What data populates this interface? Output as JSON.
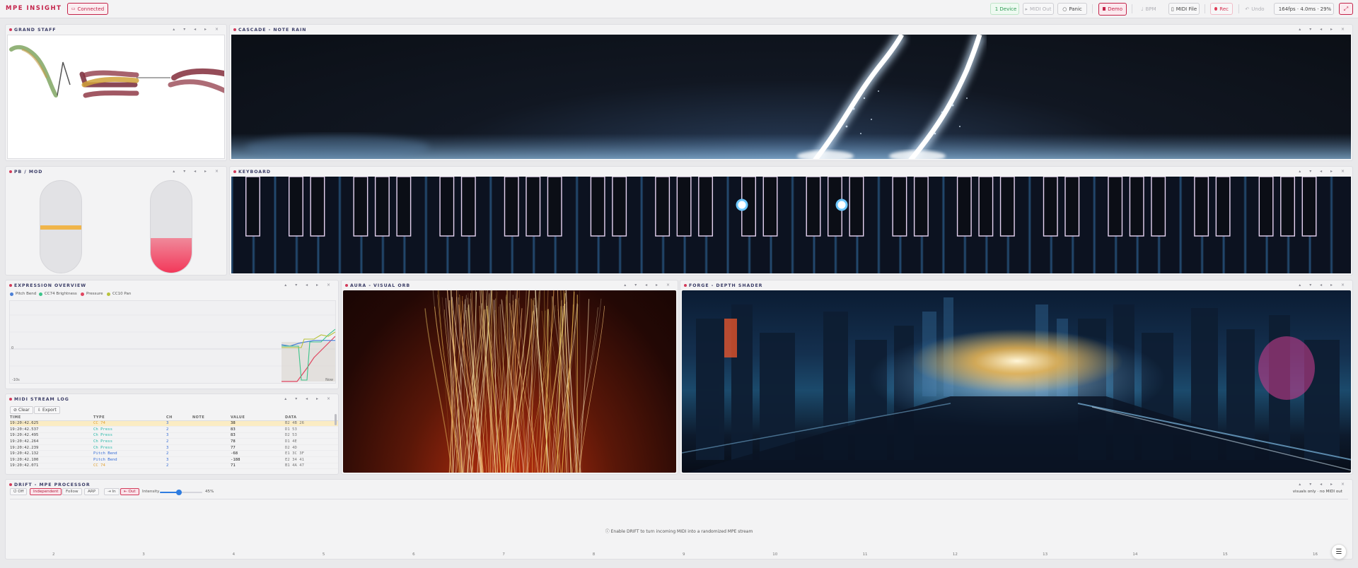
{
  "app": {
    "brand": "MPE INSIGHT"
  },
  "topbar": {
    "connected": "Connected",
    "device": "1 Device",
    "midi_out": "MIDI Out",
    "panic": "Panic",
    "demo": "Demo",
    "bpm": "BPM",
    "midi_file": "MIDI File",
    "rec": "Rec",
    "undo": "Undo",
    "perf": "164fps · 4.0ms · 29%"
  },
  "panels": {
    "grand_staff": "GRAND STAFF",
    "cascade": "CASCADE - NOTE RAIN",
    "pbmod": "PB / MOD",
    "keyboard": "KEYBOARD",
    "expression": "EXPRESSION OVERVIEW",
    "aura": "AURA - VISUAL ORB",
    "forge": "FORGE - DEPTH SHADER",
    "midi_log": "MIDI STREAM LOG",
    "drift": "DRIFT - MPE PROCESSOR"
  },
  "panel_controls": "▴ ▾ ◂ ▸ ×",
  "pbmod": {
    "pitch_bend_level": 0.5,
    "mod_level": 0.38
  },
  "expression": {
    "legend": [
      {
        "label": "Pitch Bend",
        "color": "#4a7fd6"
      },
      {
        "label": "CC74 Brightness",
        "color": "#3cc48a"
      },
      {
        "label": "Pressure",
        "color": "#e0455f"
      },
      {
        "label": "CC10 Pan",
        "color": "#b8c23a"
      }
    ],
    "y_label": "0",
    "x_start": "-10s",
    "x_end": "Now"
  },
  "midi_log": {
    "clear": "Clear",
    "export": "Export",
    "columns": [
      "TIME",
      "TYPE",
      "CH",
      "NOTE",
      "VALUE",
      "DATA"
    ],
    "rows": [
      {
        "time": "19:20:42.625",
        "type": "CC 74",
        "ch": "3",
        "note": "",
        "value": "38",
        "data": "B2 4B 26"
      },
      {
        "time": "19:20:42.537",
        "type": "Ch Press",
        "ch": "2",
        "note": "",
        "value": "83",
        "data": "D1 53"
      },
      {
        "time": "19:20:42.495",
        "type": "Ch Press",
        "ch": "3",
        "note": "",
        "value": "83",
        "data": "D2 53"
      },
      {
        "time": "19:20:42.264",
        "type": "Ch Press",
        "ch": "2",
        "note": "",
        "value": "78",
        "data": "D1 4E"
      },
      {
        "time": "19:20:42.239",
        "type": "Ch Press",
        "ch": "3",
        "note": "",
        "value": "77",
        "data": "D2 4D"
      },
      {
        "time": "19:20:42.132",
        "type": "Pitch Bend",
        "ch": "2",
        "note": "",
        "value": "-68",
        "data": "E1 3C 3F"
      },
      {
        "time": "19:20:42.100",
        "type": "Pitch Bend",
        "ch": "3",
        "note": "",
        "value": "-188",
        "data": "E2 34 41"
      },
      {
        "time": "19:20:42.071",
        "type": "CC 74",
        "ch": "2",
        "note": "",
        "value": "71",
        "data": "B1 4A 47"
      }
    ]
  },
  "drift": {
    "modes": [
      "Off",
      "Independent",
      "Follow",
      "ARP"
    ],
    "active_mode": "Independent",
    "in": "In",
    "out": "Out",
    "intensity_label": "Intensity",
    "intensity_value": "45%",
    "intensity": 45,
    "status": "visuals only · no MIDI out",
    "hint": "Enable DRIFT to turn incoming MIDI into a randomized MPE stream",
    "ticks": [
      "2",
      "3",
      "4",
      "5",
      "6",
      "7",
      "8",
      "9",
      "10",
      "11",
      "12",
      "13",
      "14",
      "15",
      "16"
    ]
  },
  "fab_icon": "menu-icon"
}
